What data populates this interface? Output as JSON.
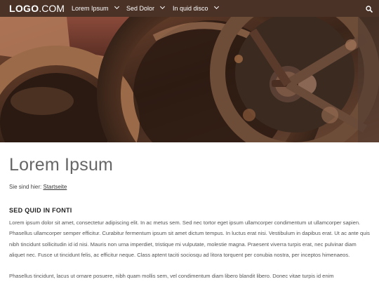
{
  "header": {
    "logo_main": "LOGO",
    "logo_suffix": ".COM",
    "nav": [
      {
        "label": "Lorem Ipsum"
      },
      {
        "label": "Sed Dolor"
      },
      {
        "label": "In quid disco"
      }
    ],
    "search_icon": "search-icon"
  },
  "colors": {
    "header_bg": "#4a3227",
    "title": "#666666"
  },
  "main": {
    "title": "Lorem Ipsum",
    "breadcrumb_prefix": "Sie sind hier:",
    "breadcrumb_link": "Startseite",
    "section_title": "SED QUID IN FONTI",
    "paragraph1": "Lorem ipsum dolor sit amet, consectetur adipiscing elit. In ac metus sem. Sed nec tortor eget ipsum ullamcorper condimentum ut ullamcorper sapien. Phasellus ullamcorper semper efficitur. Curabitur fermentum ipsum sit amet dictum tempus. In luctus erat nisi. Vestibulum in dapibus erat. Ut ac ante quis nibh tincidunt sollicitudin id id nisi. Mauris non urna imperdiet, tristique mi vulputate, molestie magna. Praesent viverra turpis erat, nec pulvinar diam aliquet nec. Fusce ut tincidunt felis, ac efficitur neque. Class aptent taciti sociosqu ad litora torquent per conubia nostra, per inceptos himenaeos.",
    "paragraph2": "Phasellus tincidunt, lacus ut ornare posuere, nibh quam mollis sem, vel condimentum diam libero blandit libero. Donec vitae turpis id enim"
  }
}
